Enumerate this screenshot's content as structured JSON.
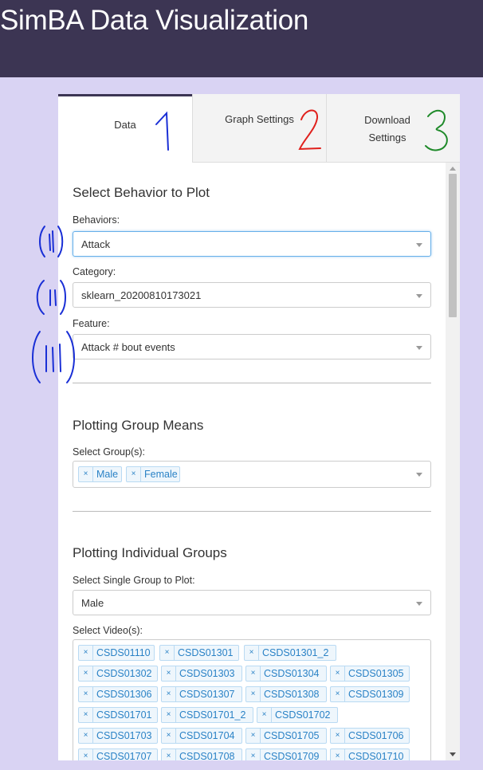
{
  "app": {
    "title": "SimBA Data Visualization"
  },
  "tabs": [
    {
      "label": "Data"
    },
    {
      "label": "Graph Settings"
    },
    {
      "label": "Download Settings"
    }
  ],
  "select_behavior": {
    "title": "Select Behavior to Plot",
    "behaviors": {
      "label": "Behaviors:",
      "value": "Attack"
    },
    "category": {
      "label": "Category:",
      "value": "sklearn_20200810173021"
    },
    "feature": {
      "label": "Feature:",
      "value": "Attack # bout events"
    }
  },
  "group_means": {
    "title": "Plotting Group Means",
    "groups_label": "Select Group(s):",
    "groups": [
      "Male",
      "Female"
    ]
  },
  "individual_groups": {
    "title": "Plotting Individual Groups",
    "single_group_label": "Select Single Group to Plot:",
    "single_group_value": "Male",
    "videos_label": "Select Video(s):",
    "videos": [
      "CSDS01110",
      "CSDS01301",
      "CSDS01301_2",
      "CSDS01302",
      "CSDS01303",
      "CSDS01304",
      "CSDS01305",
      "CSDS01306",
      "CSDS01307",
      "CSDS01308",
      "CSDS01309",
      "CSDS01701",
      "CSDS01701_2",
      "CSDS01702",
      "CSDS01703",
      "CSDS01704",
      "CSDS01705",
      "CSDS01706",
      "CSDS01707",
      "CSDS01708",
      "CSDS01709",
      "CSDS01710"
    ]
  },
  "annotations": {
    "tab_numbers": [
      "1",
      "2",
      "3"
    ],
    "roman_numerals": [
      "i",
      "ii",
      "iii"
    ],
    "colors": {
      "blue": "#1a2fd6",
      "red": "#e0201c",
      "green": "#1f8a2a"
    }
  },
  "colors": {
    "header_bg": "#3c3553",
    "page_bg": "#d9d3f3",
    "tag_text": "#2a82c6",
    "tag_bg": "#eef6fc"
  }
}
